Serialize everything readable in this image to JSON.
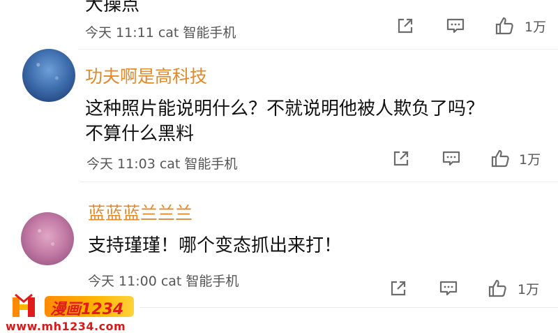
{
  "comments": [
    {
      "clipped_text": "大操点",
      "meta": "今天 11:11 cat 智能手机",
      "like_count": "1万"
    },
    {
      "username": "功夫啊是高科技",
      "content_line1": "这种照片能说明什么？不就说明他被人欺负了吗？",
      "content_line2": "不算什么黑料",
      "meta": "今天 11:03 cat 智能手机",
      "like_count": "1万"
    },
    {
      "username": "蓝蓝蓝兰兰兰",
      "content_line1": "支持瑾瑾！哪个变态抓出来打！",
      "meta": "今天 11:00 cat 智能手机",
      "like_count": "1万"
    }
  ],
  "icons": [
    "share-icon",
    "comment-icon",
    "like-icon"
  ],
  "colors": {
    "username": "#e08a2a",
    "meta": "#555555",
    "icon": "#6b6b6b",
    "watermark_red": "#d81a1a"
  },
  "watermark": {
    "badge_text": "漫画1234",
    "url": "www.mh1234.com"
  }
}
